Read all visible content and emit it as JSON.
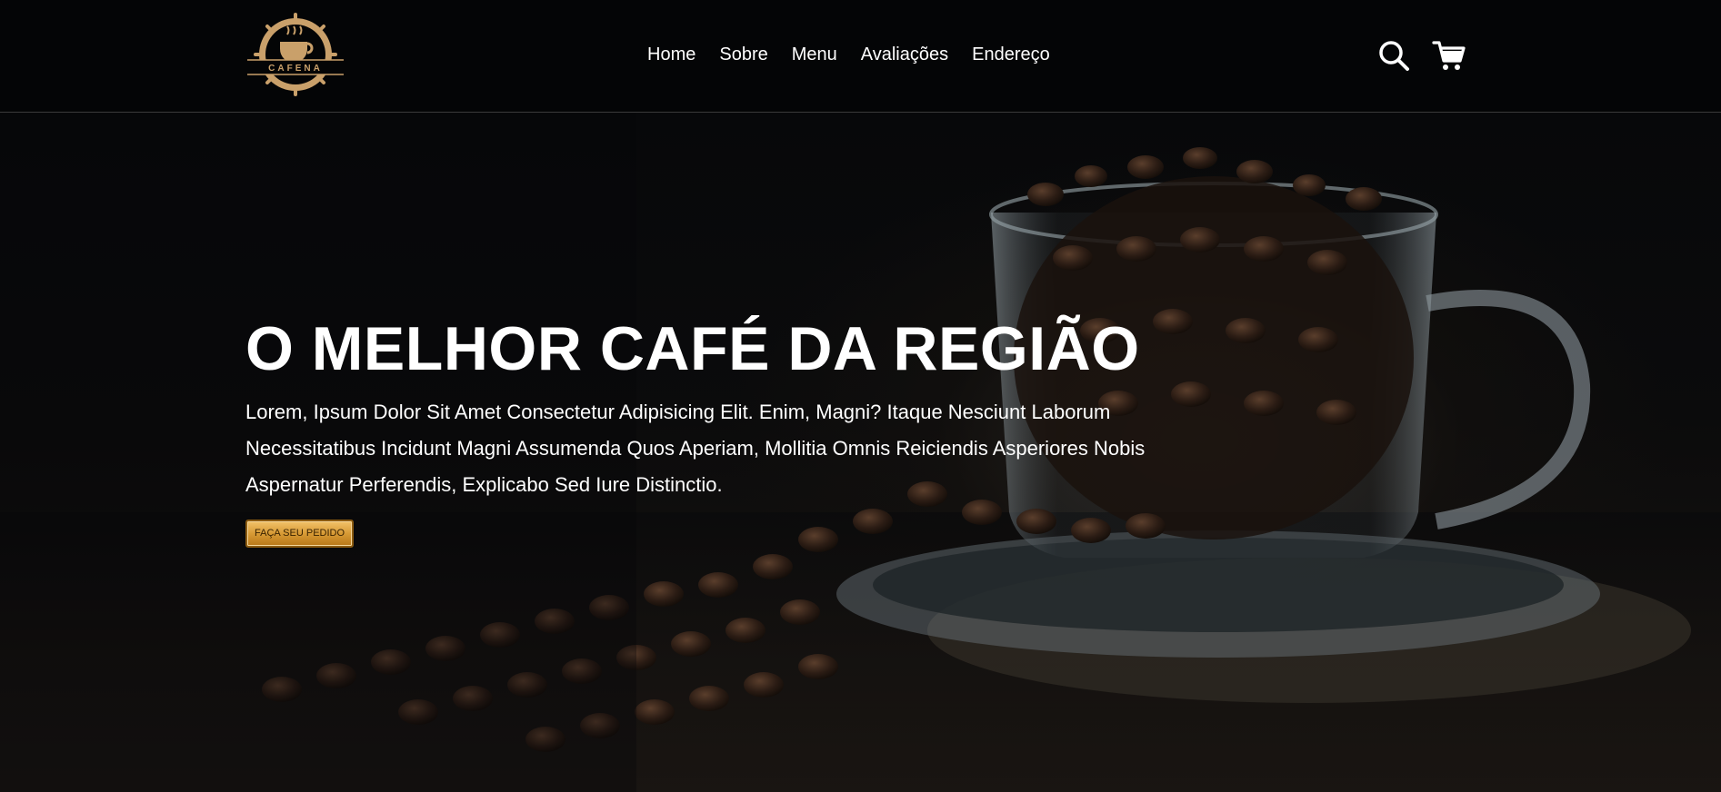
{
  "brand": {
    "logo_text": "CAFENA",
    "accent": "#c9a06a"
  },
  "nav": {
    "items": [
      {
        "label": "Home"
      },
      {
        "label": "Sobre"
      },
      {
        "label": "Menu"
      },
      {
        "label": "Avaliações"
      },
      {
        "label": "Endereço"
      }
    ]
  },
  "header_icons": {
    "search": "search-icon",
    "cart": "cart-icon"
  },
  "hero": {
    "title": "O MELHOR CAFÉ DA REGIÃO",
    "text": "Lorem, Ipsum Dolor Sit Amet Consectetur Adipisicing Elit. Enim, Magni? Itaque Nesciunt Laborum Necessitatibus Incidunt Magni Assumenda Quos Aperiam, Mollitia Omnis Reiciendis Asperiores Nobis Aspernatur Perferendis, Explicabo Sed Iure Distinctio.",
    "cta_label": "FAÇA SEU PEDIDO",
    "cta_color": "#d79a35",
    "background": "coffee-beans-glass-cup-photo"
  }
}
